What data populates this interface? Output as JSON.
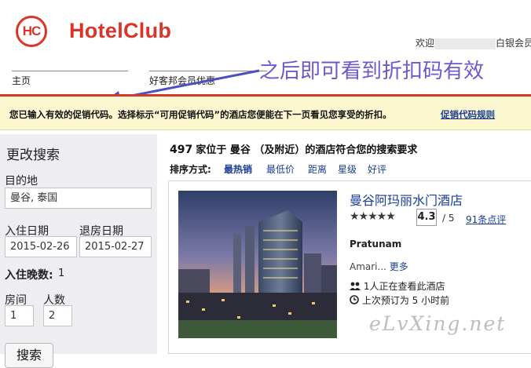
{
  "header": {
    "logo_mark": "HC",
    "logo_text": "HotelClub",
    "welcome_prefix": "欢迎",
    "welcome_suffix": "白银会员"
  },
  "nav": {
    "home": "主页",
    "member_deals": "好客邦会员优惠"
  },
  "annotation": "之后即可看到折扣码有效",
  "banner": {
    "message": "您已输入有效的促销代码。选择标示“可用促销代码”的酒店您便能在下一页看见您享受的折扣。",
    "rules_link": "促销代码规则"
  },
  "sidebar": {
    "title": "更改搜索",
    "destination_label": "目的地",
    "destination_value": "曼谷, 泰国",
    "checkin_label": "入住日期",
    "checkin_value": "2015-02-26",
    "checkout_label": "退房日期",
    "checkout_value": "2015-02-27",
    "nights_label": "入住晚数:",
    "nights_value": "1",
    "rooms_label": "房间",
    "rooms_value": "1",
    "persons_label": "人数",
    "persons_value": "2",
    "search_button": "搜索"
  },
  "results": {
    "count": "497",
    "count_text": "家位于 曼谷 （及附近）的酒店符合您的搜索要求",
    "sort_label": "排序方式:",
    "sort_options": [
      "最热销",
      "最低价",
      "距离",
      "星级",
      "好评"
    ]
  },
  "hotel": {
    "name": "曼谷阿玛丽水门酒店",
    "stars": "★★★★★",
    "star_rating": 5,
    "score": "4.3",
    "score_max": "/ 5",
    "reviews": "91条点评",
    "area": "Pratunam",
    "amenity_text": "Amari...",
    "more_link": "更多",
    "viewing": "1人正在查看此酒店",
    "last_booked": "上次预订为 5 小时前"
  },
  "watermark": "eLvXing.net",
  "colors": {
    "brand_red": "#d9352b",
    "link_blue": "#1a3e95",
    "banner_bg": "#fdf7cf",
    "annotation_purple": "#6a5acd"
  }
}
